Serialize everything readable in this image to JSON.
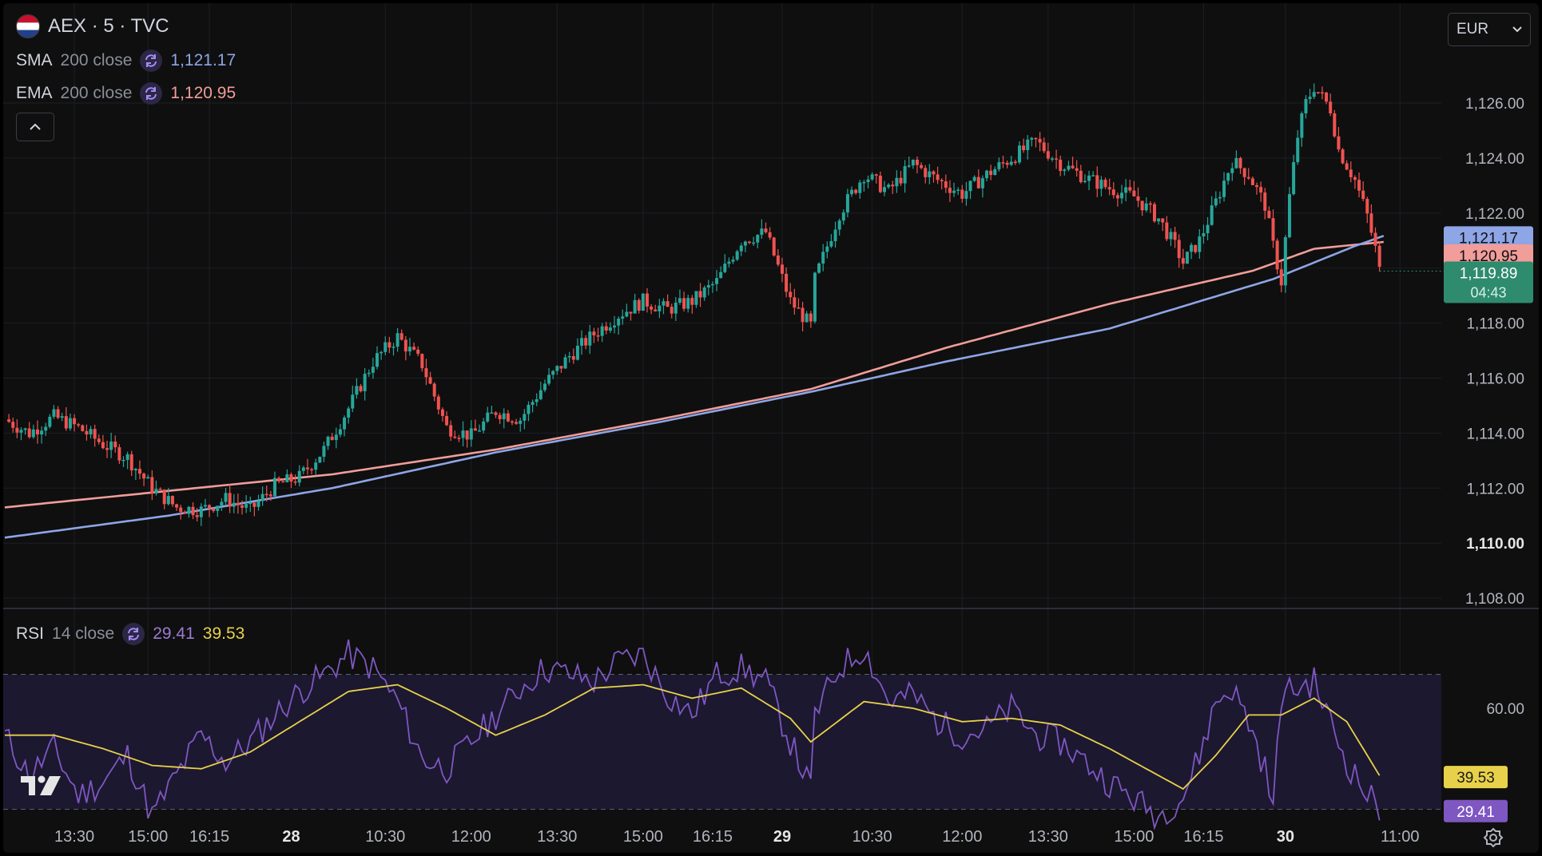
{
  "header": {
    "symbol_line": "AEX · 5 · TVC",
    "sma": {
      "name": "SMA",
      "params": "200 close",
      "value": "1,121.17",
      "color": "#8ea5e6"
    },
    "ema": {
      "name": "EMA",
      "params": "200 close",
      "value": "1,120.95",
      "color": "#f19d9a"
    },
    "rsi": {
      "name": "RSI",
      "params": "14 close",
      "value": "29.41",
      "ma_value": "39.53",
      "color": "#7e57c2",
      "ma_color": "#e8d14a"
    }
  },
  "currency": "EUR",
  "price_badges": {
    "sma": "1,121.17",
    "ema": "1,120.95",
    "last": "1,119.89",
    "countdown": "04:43"
  },
  "colors": {
    "up": "#26a69a",
    "down": "#ef5350",
    "sma": "#8ea5e6",
    "ema": "#f19d9a",
    "rsi": "#7e57c2",
    "rsi_ma": "#e8d14a",
    "last": "#2e8b6e"
  },
  "chart_data": [
    {
      "type": "candlestick",
      "title": "AEX · 5 · TVC",
      "ylim": [
        1107.5,
        1128.5
      ],
      "y_ticks": [
        "1,108.00",
        "1,110.00",
        "1,112.00",
        "1,114.00",
        "1,116.00",
        "1,118.00",
        "1,120.00",
        "1,122.00",
        "1,124.00",
        "1,126.00"
      ],
      "x_ticks": [
        "13:30",
        "15:00",
        "16:15",
        "28",
        "10:30",
        "12:00",
        "13:30",
        "15:00",
        "16:15",
        "29",
        "10:30",
        "12:00",
        "13:30",
        "15:00",
        "16:15",
        "30",
        "11:00"
      ],
      "close_path": [
        [
          0,
          1114.5
        ],
        [
          6,
          1114.0
        ],
        [
          12,
          1114.6
        ],
        [
          18,
          1114.2
        ],
        [
          24,
          1113.6
        ],
        [
          30,
          1113.1
        ],
        [
          36,
          1112.0
        ],
        [
          42,
          1111.3
        ],
        [
          48,
          1111.2
        ],
        [
          54,
          1111.6
        ],
        [
          60,
          1111.2
        ],
        [
          66,
          1112.1
        ],
        [
          72,
          1112.4
        ],
        [
          78,
          1113.4
        ],
        [
          84,
          1114.9
        ],
        [
          90,
          1116.6
        ],
        [
          96,
          1117.5
        ],
        [
          102,
          1116.5
        ],
        [
          108,
          1114.2
        ],
        [
          114,
          1113.9
        ],
        [
          120,
          1114.8
        ],
        [
          126,
          1114.5
        ],
        [
          132,
          1115.8
        ],
        [
          138,
          1116.8
        ],
        [
          144,
          1117.6
        ],
        [
          150,
          1118.3
        ],
        [
          156,
          1118.8
        ],
        [
          162,
          1118.5
        ],
        [
          168,
          1118.8
        ],
        [
          174,
          1119.5
        ],
        [
          180,
          1121.0
        ],
        [
          186,
          1121.3
        ],
        [
          192,
          1118.8
        ],
        [
          197,
          1117.9
        ],
        [
          198,
          1119.6
        ],
        [
          204,
          1122.0
        ],
        [
          210,
          1123.4
        ],
        [
          216,
          1122.8
        ],
        [
          222,
          1123.8
        ],
        [
          228,
          1123.2
        ],
        [
          234,
          1122.7
        ],
        [
          240,
          1123.4
        ],
        [
          246,
          1124.0
        ],
        [
          252,
          1124.6
        ],
        [
          258,
          1123.8
        ],
        [
          264,
          1123.3
        ],
        [
          270,
          1122.9
        ],
        [
          276,
          1122.6
        ],
        [
          282,
          1121.8
        ],
        [
          286,
          1120.8
        ],
        [
          288,
          1120.2
        ],
        [
          292,
          1121.0
        ],
        [
          296,
          1122.4
        ],
        [
          300,
          1123.9
        ],
        [
          304,
          1123.4
        ],
        [
          308,
          1122.3
        ],
        [
          310,
          1120.8
        ],
        [
          312,
          1119.5
        ],
        [
          314,
          1122.6
        ],
        [
          316,
          1124.8
        ],
        [
          318,
          1126.0
        ],
        [
          320,
          1126.6
        ],
        [
          324,
          1125.8
        ],
        [
          326,
          1124.3
        ],
        [
          330,
          1123.2
        ],
        [
          333,
          1121.9
        ],
        [
          335,
          1120.7
        ],
        [
          336,
          1119.9
        ]
      ],
      "sma_series": [
        [
          0,
          1110.2
        ],
        [
          40,
          1111.0
        ],
        [
          80,
          1112.0
        ],
        [
          120,
          1113.3
        ],
        [
          160,
          1114.4
        ],
        [
          197,
          1115.5
        ],
        [
          230,
          1116.6
        ],
        [
          270,
          1117.8
        ],
        [
          310,
          1119.6
        ],
        [
          330,
          1120.8
        ],
        [
          337,
          1121.17
        ]
      ],
      "ema_series": [
        [
          0,
          1111.3
        ],
        [
          40,
          1111.9
        ],
        [
          80,
          1112.5
        ],
        [
          120,
          1113.4
        ],
        [
          160,
          1114.5
        ],
        [
          197,
          1115.6
        ],
        [
          230,
          1117.1
        ],
        [
          270,
          1118.7
        ],
        [
          305,
          1119.9
        ],
        [
          320,
          1120.7
        ],
        [
          337,
          1120.95
        ]
      ],
      "sma_last": 1121.17,
      "ema_last": 1120.95,
      "last_price": 1119.89
    },
    {
      "type": "line",
      "title": "RSI 14 close",
      "ylim": [
        23,
        82
      ],
      "y_ticks": [
        "60.00"
      ],
      "bands": [
        70,
        50,
        30
      ],
      "rsi_series": [
        [
          0,
          52
        ],
        [
          6,
          40
        ],
        [
          12,
          48
        ],
        [
          18,
          34
        ],
        [
          24,
          38
        ],
        [
          30,
          46
        ],
        [
          36,
          28
        ],
        [
          42,
          40
        ],
        [
          48,
          52
        ],
        [
          54,
          44
        ],
        [
          60,
          50
        ],
        [
          66,
          58
        ],
        [
          72,
          65
        ],
        [
          78,
          70
        ],
        [
          84,
          76
        ],
        [
          90,
          72
        ],
        [
          96,
          62
        ],
        [
          102,
          45
        ],
        [
          108,
          42
        ],
        [
          114,
          50
        ],
        [
          120,
          58
        ],
        [
          126,
          66
        ],
        [
          132,
          72
        ],
        [
          138,
          70
        ],
        [
          144,
          68
        ],
        [
          150,
          74
        ],
        [
          156,
          76
        ],
        [
          162,
          64
        ],
        [
          168,
          58
        ],
        [
          174,
          70
        ],
        [
          180,
          72
        ],
        [
          186,
          68
        ],
        [
          192,
          50
        ],
        [
          197,
          36
        ],
        [
          198,
          58
        ],
        [
          204,
          72
        ],
        [
          210,
          78
        ],
        [
          216,
          62
        ],
        [
          222,
          64
        ],
        [
          228,
          56
        ],
        [
          234,
          52
        ],
        [
          240,
          54
        ],
        [
          246,
          60
        ],
        [
          252,
          52
        ],
        [
          258,
          50
        ],
        [
          264,
          44
        ],
        [
          270,
          38
        ],
        [
          276,
          33
        ],
        [
          282,
          28
        ],
        [
          288,
          34
        ],
        [
          292,
          46
        ],
        [
          296,
          62
        ],
        [
          300,
          66
        ],
        [
          304,
          56
        ],
        [
          308,
          42
        ],
        [
          310,
          30
        ],
        [
          312,
          64
        ],
        [
          316,
          66
        ],
        [
          320,
          68
        ],
        [
          324,
          56
        ],
        [
          328,
          44
        ],
        [
          332,
          36
        ],
        [
          336,
          30
        ]
      ],
      "rsi_ma_series": [
        [
          0,
          52
        ],
        [
          12,
          52
        ],
        [
          24,
          48
        ],
        [
          36,
          43
        ],
        [
          48,
          42
        ],
        [
          60,
          47
        ],
        [
          72,
          56
        ],
        [
          84,
          65
        ],
        [
          96,
          67
        ],
        [
          108,
          60
        ],
        [
          120,
          52
        ],
        [
          132,
          58
        ],
        [
          144,
          66
        ],
        [
          156,
          67
        ],
        [
          168,
          63
        ],
        [
          180,
          66
        ],
        [
          192,
          57
        ],
        [
          197,
          50
        ],
        [
          210,
          62
        ],
        [
          222,
          60
        ],
        [
          234,
          56
        ],
        [
          246,
          57
        ],
        [
          258,
          55
        ],
        [
          270,
          48
        ],
        [
          282,
          40
        ],
        [
          288,
          36
        ],
        [
          296,
          46
        ],
        [
          304,
          58
        ],
        [
          312,
          58
        ],
        [
          320,
          63
        ],
        [
          328,
          56
        ],
        [
          336,
          40
        ]
      ],
      "rsi_last": 29.41,
      "rsi_ma_last": 39.53
    }
  ]
}
